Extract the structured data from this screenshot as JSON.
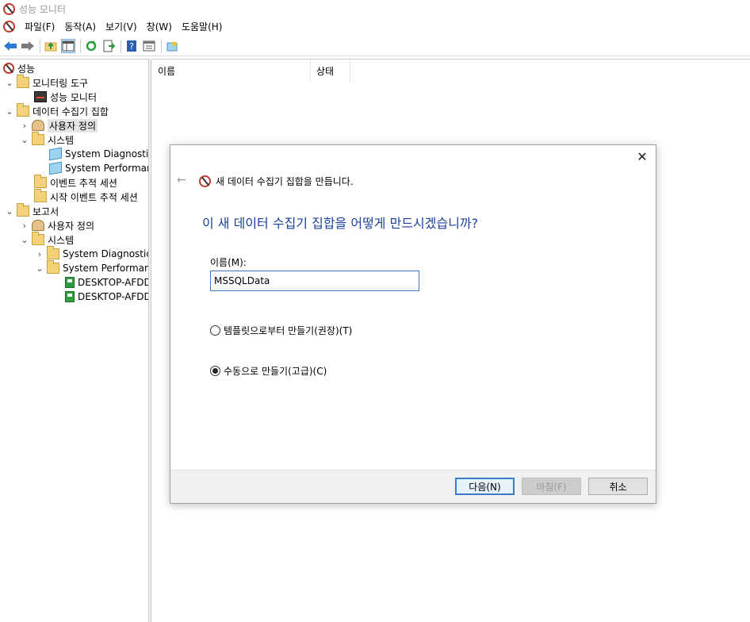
{
  "window": {
    "title": "성능 모니터"
  },
  "menu": [
    "파일(F)",
    "동작(A)",
    "보기(V)",
    "창(W)",
    "도움말(H)"
  ],
  "tree": {
    "root": "성능",
    "monitoring_tools": "모니터링 도구",
    "perf_monitor": "성능 모니터",
    "dcs": "데이터 수집기 집합",
    "user_defined": "사용자 정의",
    "system": "시스템",
    "sys_diag": "System Diagnostics",
    "sys_perf": "System Performance",
    "event_trace": "이벤트 추적 세션",
    "startup_trace": "시작 이벤트 추적 세션",
    "reports": "보고서",
    "rep_user_defined": "사용자 정의",
    "rep_system": "시스템",
    "rep_sys_diag": "System Diagnostics",
    "rep_sys_perf": "System Performance",
    "desktop1": "DESKTOP-AFDD",
    "desktop2": "DESKTOP-AFDD"
  },
  "list": {
    "col_name": "이름",
    "col_status": "상태"
  },
  "dialog": {
    "header": "새 데이터 수집기 집합을 만듭니다.",
    "question": "이 새 데이터 수집기 집합을 어떻게 만드시겠습니까?",
    "name_label": "이름(M):",
    "name_value": "MSSQLData",
    "option_template": "템플릿으로부터 만들기(권장)(T)",
    "option_manual": "수동으로 만들기(고급)(C)",
    "selected_option": "manual",
    "btn_next": "다음(N)",
    "btn_finish": "마침(F)",
    "btn_cancel": "취소"
  }
}
